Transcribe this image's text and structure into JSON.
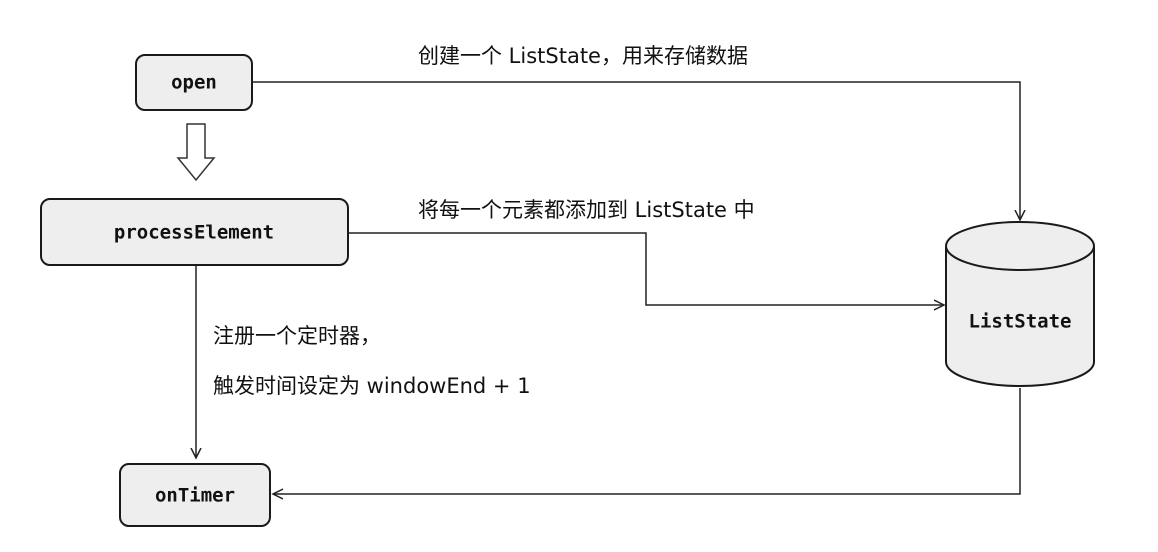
{
  "diagram": {
    "nodes": {
      "open": "open",
      "process_element": "processElement",
      "list_state": "ListState",
      "on_timer": "onTimer"
    },
    "edges": {
      "open_to_state": "创建一个 ListState，用来存储数据",
      "process_to_state": "将每一个元素都添加到 ListState 中",
      "process_to_timer_line1": "注册一个定时器，",
      "process_to_timer_line2": "触发时间设定为 windowEnd + 1"
    }
  },
  "colors": {
    "node_fill": "#eeeeee",
    "stroke": "#1a1a1a",
    "text": "#111111"
  }
}
